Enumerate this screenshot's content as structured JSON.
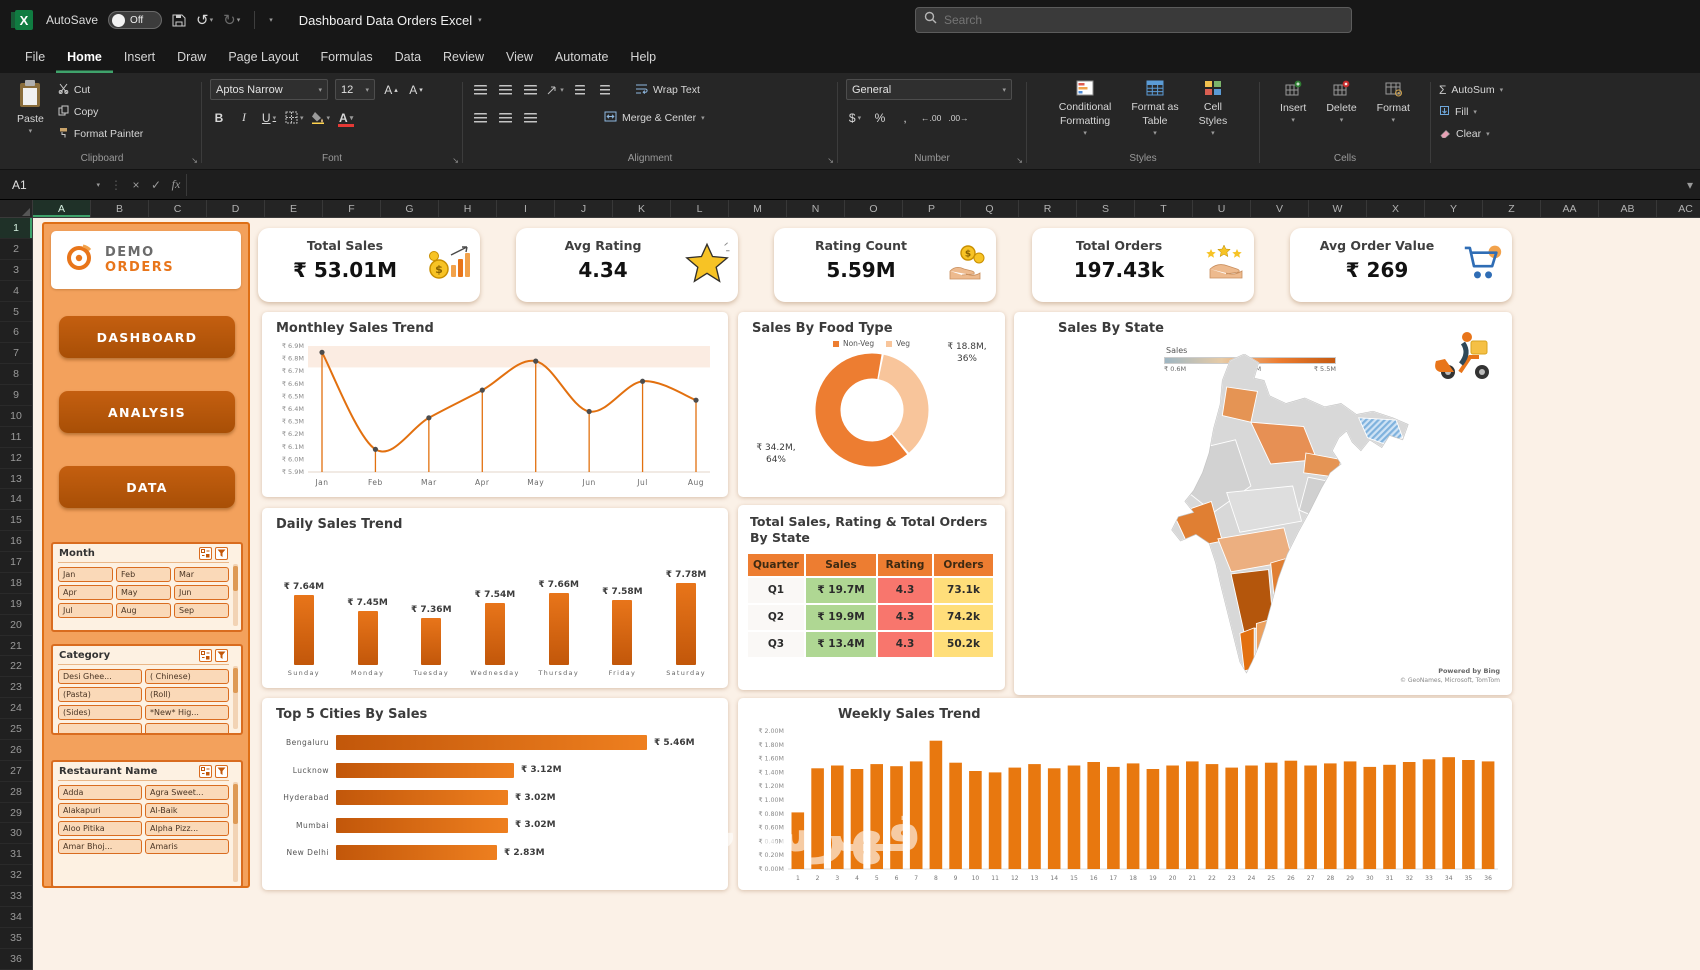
{
  "titlebar": {
    "autosave_label": "AutoSave",
    "autosave_state": "Off",
    "doc_title": "Dashboard Data Orders Excel",
    "search_placeholder": "Search"
  },
  "menubar": {
    "tabs": [
      "File",
      "Home",
      "Insert",
      "Draw",
      "Page Layout",
      "Formulas",
      "Data",
      "Review",
      "View",
      "Automate",
      "Help"
    ],
    "active": "Home"
  },
  "ribbon": {
    "clipboard": {
      "group_label": "Clipboard",
      "paste": "Paste",
      "cut": "Cut",
      "copy": "Copy",
      "format_painter": "Format Painter"
    },
    "font": {
      "group_label": "Font",
      "font_name": "Aptos Narrow",
      "font_size": "12"
    },
    "alignment": {
      "group_label": "Alignment",
      "wrap_text": "Wrap Text",
      "merge_center": "Merge & Center"
    },
    "number": {
      "group_label": "Number",
      "format": "General"
    },
    "styles": {
      "group_label": "Styles",
      "conditional_line1": "Conditional",
      "conditional_line2": "Formatting",
      "table_line1": "Format as",
      "table_line2": "Table",
      "cellstyles_line1": "Cell",
      "cellstyles_line2": "Styles"
    },
    "cells": {
      "group_label": "Cells",
      "insert": "Insert",
      "delete": "Delete",
      "format": "Format"
    },
    "editing": {
      "autosum": "AutoSum",
      "fill": "Fill",
      "clear": "Clear"
    }
  },
  "formula_bar": {
    "cell_ref": "A1",
    "fx_label": "fx"
  },
  "grid": {
    "visible_columns": [
      "A",
      "B",
      "C",
      "D",
      "E",
      "F",
      "G",
      "H",
      "I",
      "J",
      "K",
      "L",
      "M",
      "N",
      "O",
      "P",
      "Q",
      "R",
      "S",
      "T",
      "U",
      "V",
      "W",
      "X",
      "Y",
      "Z",
      "AA",
      "AB",
      "AC"
    ],
    "visible_rows": 36,
    "selected_column": "A",
    "selected_row": 1
  },
  "sidebar": {
    "logo": {
      "brand_top": "DEMO",
      "brand_bottom": "ORDERS"
    },
    "nav": [
      "DASHBOARD",
      "ANALYSIS",
      "DATA"
    ],
    "slicers": [
      {
        "title": "Month",
        "columns": 3,
        "items": [
          "Jan",
          "Feb",
          "Mar",
          "Apr",
          "May",
          "Jun",
          "Jul",
          "Aug",
          "Sep"
        ]
      },
      {
        "title": "Category",
        "columns": 2,
        "items": [
          "Desi Ghee...",
          "( Chinese)",
          "(Pasta)",
          "(Roll)",
          "(Sides)",
          "*New* Hig..."
        ],
        "clipped_items": 2
      },
      {
        "title": "Restaurant Name",
        "columns": 2,
        "items": [
          "Adda",
          "Agra Sweet...",
          "Alakapuri",
          "Al-Baik",
          "Aloo Pitika",
          "Alpha Pizz...",
          "Amar Bhoj...",
          "Amaris"
        ]
      }
    ]
  },
  "kpis": [
    {
      "label": "Total Sales",
      "value": "₹ 53.01M",
      "icon": "sales-coins-icon"
    },
    {
      "label": "Avg Rating",
      "value": "4.34",
      "icon": "star-icon"
    },
    {
      "label": "Rating Count",
      "value": "5.59M",
      "icon": "rating-hand-icon"
    },
    {
      "label": "Total Orders",
      "value": "197.43k",
      "icon": "orders-stars-icon"
    },
    {
      "label": "Avg Order Value",
      "value": "₹ 269",
      "icon": "cart-icon"
    }
  ],
  "map_panel": {
    "title": "Sales By State",
    "legend_label": "Sales",
    "legend_ticks": [
      "₹ 0.6M",
      "₹ 3.0M",
      "₹ 5.5M"
    ],
    "attribution_line1": "Powered by Bing",
    "attribution_line2": "© GeoNames, Microsoft, TomTom"
  },
  "watermark": "فهرسات",
  "chart_data": [
    {
      "id": "monthly",
      "type": "line",
      "title": "Monthley Sales Trend",
      "x": [
        "Jan",
        "Feb",
        "Mar",
        "Apr",
        "May",
        "Jun",
        "Jul",
        "Aug"
      ],
      "values": [
        6.85,
        6.08,
        6.33,
        6.55,
        6.78,
        6.38,
        6.62,
        6.47
      ],
      "ylabel_unit": "₹M",
      "ylim": [
        5.9,
        6.9
      ],
      "ytick_step": 0.1,
      "line_color": "#E2700F",
      "marker_color": "#4d4d4d",
      "highlight_band": [
        6.73,
        6.9
      ]
    },
    {
      "id": "food-type",
      "type": "donut",
      "title": "Sales By Food Type",
      "slices": [
        {
          "name": "Non-Veg",
          "value": 34.2,
          "pct": 64,
          "label": "₹ 34.2M, 64%",
          "color": "#ED7D31"
        },
        {
          "name": "Veg",
          "value": 18.8,
          "pct": 36,
          "label": "₹ 18.8M, 36%",
          "color": "#F8C59B"
        }
      ],
      "legend_position": "top"
    },
    {
      "id": "daily",
      "type": "bar",
      "title": "Daily Sales Trend",
      "categories": [
        "Sunday",
        "Monday",
        "Tuesday",
        "Wednesday",
        "Thursday",
        "Friday",
        "Saturday"
      ],
      "values": [
        7.64,
        7.45,
        7.36,
        7.54,
        7.66,
        7.58,
        7.78
      ],
      "labels": [
        "₹ 7.64M",
        "₹ 7.45M",
        "₹ 7.36M",
        "₹ 7.54M",
        "₹ 7.66M",
        "₹ 7.58M",
        "₹ 7.78M"
      ],
      "ylim": [
        6.8,
        7.9
      ]
    },
    {
      "id": "quarter-table",
      "type": "table",
      "title": "Total Sales, Rating & Total Orders By State",
      "headers": [
        "Quarter",
        "Sales",
        "Rating",
        "Orders"
      ],
      "rows": [
        [
          "Q1",
          "₹ 19.7M",
          "4.3",
          "73.1k"
        ],
        [
          "Q2",
          "₹ 19.9M",
          "4.3",
          "74.2k"
        ],
        [
          "Q3",
          "₹ 13.4M",
          "4.3",
          "50.2k"
        ]
      ],
      "header_bg": "#ED7D31",
      "col_bgs": [
        "#FAF8F6",
        "#AFD793",
        "#F8766D",
        "#FFDE7A"
      ]
    },
    {
      "id": "cities",
      "type": "hbar",
      "title": "Top 5 Cities By Sales",
      "categories": [
        "Bengaluru",
        "Lucknow",
        "Hyderabad",
        "Mumbai",
        "New Delhi"
      ],
      "values": [
        5.46,
        3.12,
        3.02,
        3.02,
        2.83
      ],
      "labels": [
        "₹ 5.46M",
        "₹ 3.12M",
        "₹ 3.02M",
        "₹ 3.02M",
        "₹ 2.83M"
      ],
      "xlim": [
        0,
        5.8
      ]
    },
    {
      "id": "weekly",
      "type": "bar",
      "title": "Weekly Sales Trend",
      "categories": [
        "1",
        "2",
        "3",
        "4",
        "5",
        "6",
        "7",
        "8",
        "9",
        "10",
        "11",
        "12",
        "13",
        "14",
        "15",
        "16",
        "17",
        "18",
        "19",
        "20",
        "21",
        "22",
        "23",
        "24",
        "25",
        "26",
        "27",
        "28",
        "29",
        "30",
        "31",
        "32",
        "33",
        "34",
        "35",
        "36"
      ],
      "values": [
        0.82,
        1.46,
        1.5,
        1.45,
        1.52,
        1.49,
        1.56,
        1.86,
        1.54,
        1.42,
        1.4,
        1.47,
        1.52,
        1.46,
        1.5,
        1.55,
        1.48,
        1.53,
        1.45,
        1.5,
        1.56,
        1.52,
        1.47,
        1.5,
        1.54,
        1.57,
        1.5,
        1.53,
        1.56,
        1.48,
        1.51,
        1.55,
        1.59,
        1.62,
        1.58,
        1.56
      ],
      "ylim": [
        0,
        2.0
      ],
      "ytick_step": 0.2,
      "bar_color": "#E8780F"
    }
  ]
}
